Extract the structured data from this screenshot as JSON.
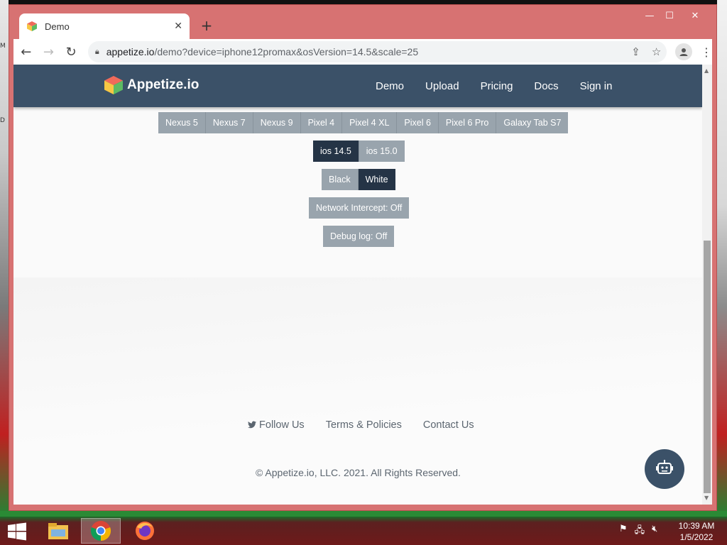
{
  "browser": {
    "tab_title": "Demo",
    "tab_close": "✕",
    "new_tab": "+",
    "url_host": "appetize.io",
    "url_rest": "/demo?device=iphone12promax&osVersion=14.5&scale=25",
    "window_controls": {
      "minimize": "—",
      "maximize": "☐",
      "close": "✕"
    }
  },
  "site": {
    "logo_text": "Appetize.io",
    "nav": [
      "Demo",
      "Upload",
      "Pricing",
      "Docs",
      "Sign in"
    ]
  },
  "devices": [
    "Nexus 5",
    "Nexus 7",
    "Nexus 9",
    "Pixel 4",
    "Pixel 4 XL",
    "Pixel 6",
    "Pixel 6 Pro",
    "Galaxy Tab S7"
  ],
  "os_versions": {
    "items": [
      "ios 14.5",
      "ios 15.0"
    ],
    "selected": "ios 14.5"
  },
  "color_mode": {
    "items": [
      "Black",
      "White"
    ],
    "selected": "White"
  },
  "network_intercept": "Network Intercept: Off",
  "debug_log": "Debug log: Off",
  "footer": {
    "follow_us": "Follow Us",
    "terms": "Terms & Policies",
    "contact": "Contact Us",
    "copyright": "© Appetize.io, LLC. 2021. All Rights Reserved."
  },
  "taskbar": {
    "time": "10:39 AM",
    "date": "1/5/2022"
  },
  "colors": {
    "navbar": "#3b5168",
    "button_inactive": "#99a4ad",
    "button_active": "#253446"
  }
}
